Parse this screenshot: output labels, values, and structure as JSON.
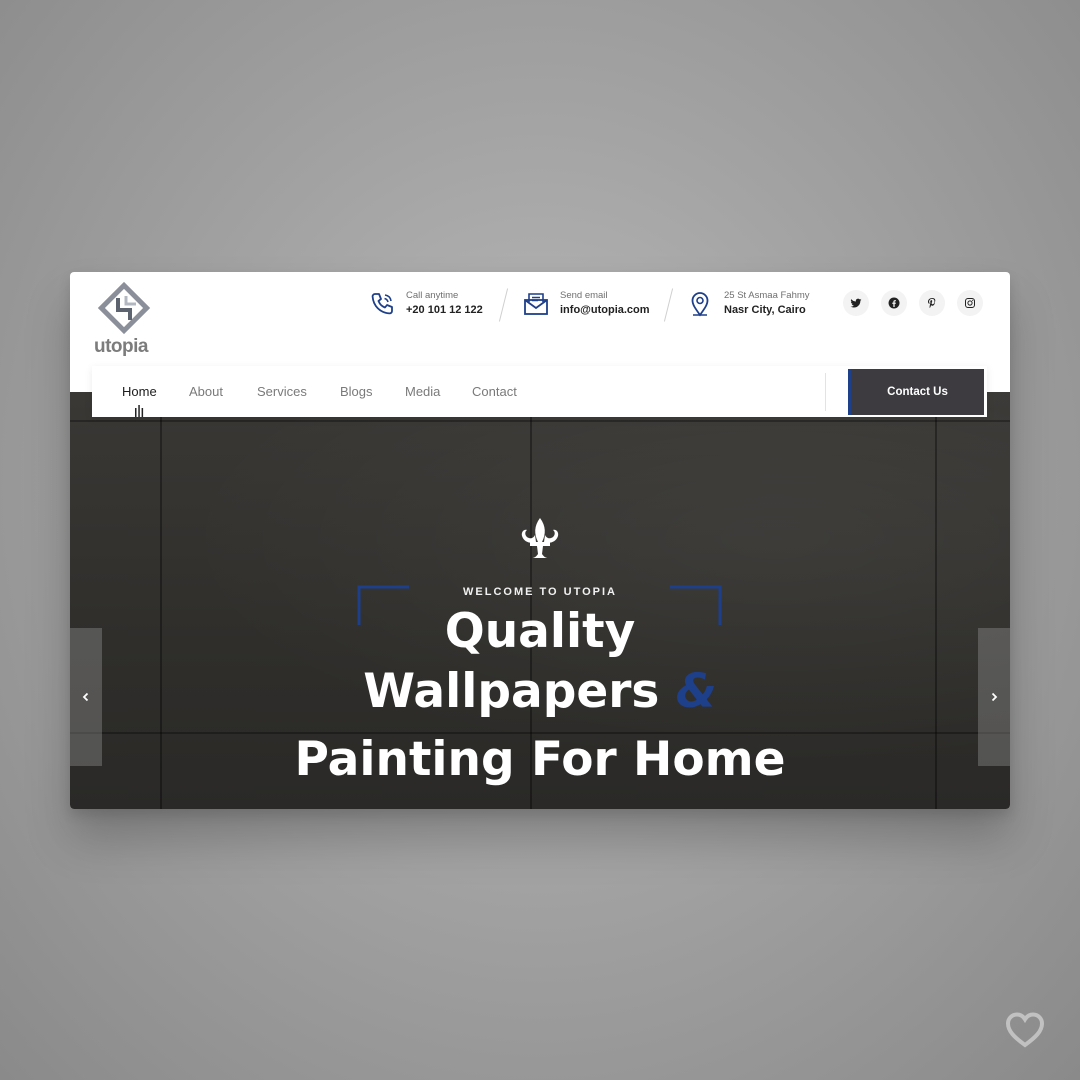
{
  "brand": {
    "logo_text": "utopia"
  },
  "topbar": {
    "call": {
      "label": "Call anytime",
      "value": "+20 101 12 122",
      "icon": "phone-icon"
    },
    "email": {
      "label": "Send email",
      "value": "info@utopia.com",
      "icon": "envelope-icon"
    },
    "address": {
      "label": "25 St Asmaa Fahmy",
      "value": "Nasr City, Cairo",
      "icon": "map-pin-icon"
    },
    "social": [
      "twitter-icon",
      "facebook-icon",
      "pinterest-icon",
      "instagram-icon"
    ]
  },
  "nav": {
    "items": [
      {
        "label": "Home",
        "active": true
      },
      {
        "label": "About"
      },
      {
        "label": "Services"
      },
      {
        "label": "Blogs"
      },
      {
        "label": "Media"
      },
      {
        "label": "Contact"
      }
    ],
    "cta_label": "Contact Us"
  },
  "hero": {
    "eyebrow": "WELCOME TO UTOPIA",
    "line1": "Quality",
    "line2": "Wallpapers",
    "amp": "&",
    "line3": "Painting For Home"
  },
  "colors": {
    "accent": "#1e3f8a",
    "cta_bg": "#3d3b3f",
    "hero_bg": "#2f2e2b"
  }
}
